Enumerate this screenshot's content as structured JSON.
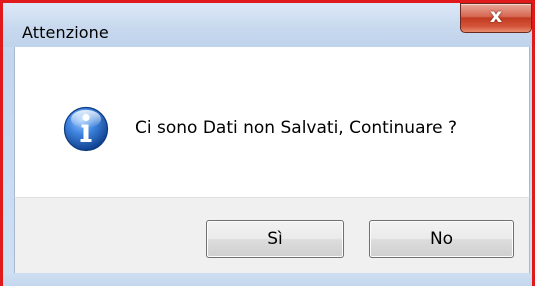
{
  "window": {
    "title": "Attenzione",
    "close_glyph": "x"
  },
  "dialog": {
    "icon": "info-icon",
    "message": "Ci sono Dati non Salvati, Continuare ?"
  },
  "buttons": {
    "yes_label": "Sì",
    "no_label": "No"
  },
  "colors": {
    "highlight_border": "#e01a1a",
    "close_button": "#c13b22",
    "info_icon_blue": "#2a6fd0"
  }
}
